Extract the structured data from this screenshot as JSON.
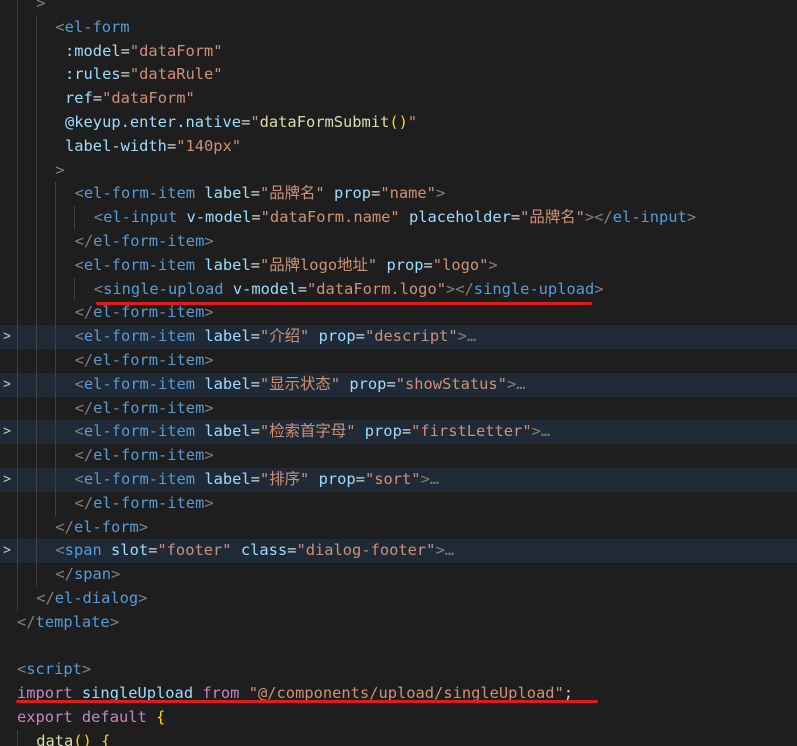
{
  "colors": {
    "background": "#1e1e1e",
    "punctuation": "#808080",
    "tag": "#569cd6",
    "attribute": "#9cdcfe",
    "string": "#ce9178",
    "keyword": "#c586c0",
    "function": "#dcdcaa",
    "brace": "#ffd700",
    "annotation": "#e01b1b"
  },
  "lines": [
    {
      "indent": 1,
      "fold": "",
      "tokens": [
        [
          "punc",
          ">"
        ]
      ]
    },
    {
      "indent": 2,
      "fold": "",
      "tokens": [
        [
          "punc",
          "<"
        ],
        [
          "tag",
          "el-form"
        ]
      ]
    },
    {
      "indent": 2.5,
      "fold": "",
      "tokens": [
        [
          "attr",
          ":model"
        ],
        [
          "eq",
          "="
        ],
        [
          "str",
          "\"dataForm\""
        ]
      ]
    },
    {
      "indent": 2.5,
      "fold": "",
      "tokens": [
        [
          "attr",
          ":rules"
        ],
        [
          "eq",
          "="
        ],
        [
          "str",
          "\"dataRule\""
        ]
      ]
    },
    {
      "indent": 2.5,
      "fold": "",
      "tokens": [
        [
          "attr",
          "ref"
        ],
        [
          "eq",
          "="
        ],
        [
          "str",
          "\"dataForm\""
        ]
      ]
    },
    {
      "indent": 2.5,
      "fold": "",
      "tokens": [
        [
          "attr",
          "@keyup.enter.native"
        ],
        [
          "eq",
          "="
        ],
        [
          "str",
          "\""
        ],
        [
          "fn",
          "dataFormSubmit"
        ],
        [
          "brace",
          "()"
        ],
        [
          "str",
          "\""
        ]
      ]
    },
    {
      "indent": 2.5,
      "fold": "",
      "tokens": [
        [
          "attr",
          "label-width"
        ],
        [
          "eq",
          "="
        ],
        [
          "str",
          "\"140px\""
        ]
      ]
    },
    {
      "indent": 2,
      "fold": "",
      "tokens": [
        [
          "punc",
          ">"
        ]
      ]
    },
    {
      "indent": 3,
      "fold": "",
      "tokens": [
        [
          "punc",
          "<"
        ],
        [
          "tag",
          "el-form-item"
        ],
        [
          "plain",
          " "
        ],
        [
          "attr",
          "label"
        ],
        [
          "eq",
          "="
        ],
        [
          "str",
          "\"品牌名\""
        ],
        [
          "plain",
          " "
        ],
        [
          "attr",
          "prop"
        ],
        [
          "eq",
          "="
        ],
        [
          "str",
          "\"name\""
        ],
        [
          "punc",
          ">"
        ]
      ]
    },
    {
      "indent": 4,
      "fold": "",
      "tokens": [
        [
          "punc",
          "<"
        ],
        [
          "tag",
          "el-input"
        ],
        [
          "plain",
          " "
        ],
        [
          "attr",
          "v-model"
        ],
        [
          "eq",
          "="
        ],
        [
          "str",
          "\"dataForm.name\""
        ],
        [
          "plain",
          " "
        ],
        [
          "attr",
          "placeholder"
        ],
        [
          "eq",
          "="
        ],
        [
          "str",
          "\"品牌名\""
        ],
        [
          "punc",
          "></"
        ],
        [
          "tag",
          "el-input"
        ],
        [
          "punc",
          ">"
        ]
      ]
    },
    {
      "indent": 3,
      "fold": "",
      "tokens": [
        [
          "punc",
          "</"
        ],
        [
          "tag",
          "el-form-item"
        ],
        [
          "punc",
          ">"
        ]
      ]
    },
    {
      "indent": 3,
      "fold": "",
      "tokens": [
        [
          "punc",
          "<"
        ],
        [
          "tag",
          "el-form-item"
        ],
        [
          "plain",
          " "
        ],
        [
          "attr",
          "label"
        ],
        [
          "eq",
          "="
        ],
        [
          "str",
          "\"品牌logo地址\""
        ],
        [
          "plain",
          " "
        ],
        [
          "attr",
          "prop"
        ],
        [
          "eq",
          "="
        ],
        [
          "str",
          "\"logo\""
        ],
        [
          "punc",
          ">"
        ]
      ]
    },
    {
      "indent": 4,
      "fold": "",
      "tokens": [
        [
          "punc",
          "<"
        ],
        [
          "tag",
          "single-upload"
        ],
        [
          "plain",
          " "
        ],
        [
          "attr",
          "v-model"
        ],
        [
          "eq",
          "="
        ],
        [
          "str",
          "\"dataForm.logo\""
        ],
        [
          "punc",
          "></"
        ],
        [
          "tag",
          "single-upload"
        ],
        [
          "punc",
          ">"
        ]
      ]
    },
    {
      "indent": 3,
      "fold": "",
      "tokens": [
        [
          "punc",
          "</"
        ],
        [
          "tag",
          "el-form-item"
        ],
        [
          "punc",
          ">"
        ]
      ]
    },
    {
      "indent": 3,
      "fold": ">",
      "tokens": [
        [
          "punc",
          "<"
        ],
        [
          "tag",
          "el-form-item"
        ],
        [
          "plain",
          " "
        ],
        [
          "attr",
          "label"
        ],
        [
          "eq",
          "="
        ],
        [
          "str",
          "\"介绍\""
        ],
        [
          "plain",
          " "
        ],
        [
          "attr",
          "prop"
        ],
        [
          "eq",
          "="
        ],
        [
          "str",
          "\"descript\""
        ],
        [
          "punc",
          ">"
        ],
        [
          "ell",
          "…"
        ]
      ]
    },
    {
      "indent": 3,
      "fold": "",
      "tokens": [
        [
          "punc",
          "</"
        ],
        [
          "tag",
          "el-form-item"
        ],
        [
          "punc",
          ">"
        ]
      ]
    },
    {
      "indent": 3,
      "fold": ">",
      "tokens": [
        [
          "punc",
          "<"
        ],
        [
          "tag",
          "el-form-item"
        ],
        [
          "plain",
          " "
        ],
        [
          "attr",
          "label"
        ],
        [
          "eq",
          "="
        ],
        [
          "str",
          "\"显示状态\""
        ],
        [
          "plain",
          " "
        ],
        [
          "attr",
          "prop"
        ],
        [
          "eq",
          "="
        ],
        [
          "str",
          "\"showStatus\""
        ],
        [
          "punc",
          ">"
        ],
        [
          "ell",
          "…"
        ]
      ]
    },
    {
      "indent": 3,
      "fold": "",
      "tokens": [
        [
          "punc",
          "</"
        ],
        [
          "tag",
          "el-form-item"
        ],
        [
          "punc",
          ">"
        ]
      ]
    },
    {
      "indent": 3,
      "fold": ">",
      "tokens": [
        [
          "punc",
          "<"
        ],
        [
          "tag",
          "el-form-item"
        ],
        [
          "plain",
          " "
        ],
        [
          "attr",
          "label"
        ],
        [
          "eq",
          "="
        ],
        [
          "str",
          "\"检索首字母\""
        ],
        [
          "plain",
          " "
        ],
        [
          "attr",
          "prop"
        ],
        [
          "eq",
          "="
        ],
        [
          "str",
          "\"firstLetter\""
        ],
        [
          "punc",
          ">"
        ],
        [
          "ell",
          "…"
        ]
      ]
    },
    {
      "indent": 3,
      "fold": "",
      "tokens": [
        [
          "punc",
          "</"
        ],
        [
          "tag",
          "el-form-item"
        ],
        [
          "punc",
          ">"
        ]
      ]
    },
    {
      "indent": 3,
      "fold": ">",
      "tokens": [
        [
          "punc",
          "<"
        ],
        [
          "tag",
          "el-form-item"
        ],
        [
          "plain",
          " "
        ],
        [
          "attr",
          "label"
        ],
        [
          "eq",
          "="
        ],
        [
          "str",
          "\"排序\""
        ],
        [
          "plain",
          " "
        ],
        [
          "attr",
          "prop"
        ],
        [
          "eq",
          "="
        ],
        [
          "str",
          "\"sort\""
        ],
        [
          "punc",
          ">"
        ],
        [
          "ell",
          "…"
        ]
      ]
    },
    {
      "indent": 3,
      "fold": "",
      "tokens": [
        [
          "punc",
          "</"
        ],
        [
          "tag",
          "el-form-item"
        ],
        [
          "punc",
          ">"
        ]
      ]
    },
    {
      "indent": 2,
      "fold": "",
      "tokens": [
        [
          "punc",
          "</"
        ],
        [
          "tag",
          "el-form"
        ],
        [
          "punc",
          ">"
        ]
      ]
    },
    {
      "indent": 2,
      "fold": ">",
      "tokens": [
        [
          "punc",
          "<"
        ],
        [
          "tag",
          "span"
        ],
        [
          "plain",
          " "
        ],
        [
          "attr",
          "slot"
        ],
        [
          "eq",
          "="
        ],
        [
          "str",
          "\"footer\""
        ],
        [
          "plain",
          " "
        ],
        [
          "attr",
          "class"
        ],
        [
          "eq",
          "="
        ],
        [
          "str",
          "\"dialog-footer\""
        ],
        [
          "punc",
          ">"
        ],
        [
          "ell",
          "…"
        ]
      ]
    },
    {
      "indent": 2,
      "fold": "",
      "tokens": [
        [
          "punc",
          "</"
        ],
        [
          "tag",
          "span"
        ],
        [
          "punc",
          ">"
        ]
      ]
    },
    {
      "indent": 1,
      "fold": "",
      "tokens": [
        [
          "punc",
          "</"
        ],
        [
          "tag",
          "el-dialog"
        ],
        [
          "punc",
          ">"
        ]
      ]
    },
    {
      "indent": 0,
      "fold": "",
      "tokens": [
        [
          "punc",
          "</"
        ],
        [
          "tag",
          "template"
        ],
        [
          "punc",
          ">"
        ]
      ]
    },
    {
      "indent": 0,
      "fold": "",
      "tokens": []
    },
    {
      "indent": 0,
      "fold": "",
      "tokens": [
        [
          "punc",
          "<"
        ],
        [
          "tag",
          "script"
        ],
        [
          "punc",
          ">"
        ]
      ]
    },
    {
      "indent": 0,
      "fold": "",
      "tokens": [
        [
          "kw",
          "import"
        ],
        [
          "plain",
          " "
        ],
        [
          "var",
          "singleUpload"
        ],
        [
          "plain",
          " "
        ],
        [
          "kw",
          "from"
        ],
        [
          "plain",
          " "
        ],
        [
          "str",
          "\"@/components/upload/singleUpload\""
        ],
        [
          "plain",
          ";"
        ]
      ]
    },
    {
      "indent": 0,
      "fold": "",
      "tokens": [
        [
          "kw",
          "export"
        ],
        [
          "plain",
          " "
        ],
        [
          "kw",
          "default"
        ],
        [
          "plain",
          " "
        ],
        [
          "brace",
          "{"
        ]
      ]
    },
    {
      "indent": 1,
      "fold": "",
      "tokens": [
        [
          "fn",
          "data"
        ],
        [
          "brace",
          "()"
        ],
        [
          "plain",
          " "
        ],
        [
          "brace",
          "{"
        ]
      ]
    }
  ]
}
